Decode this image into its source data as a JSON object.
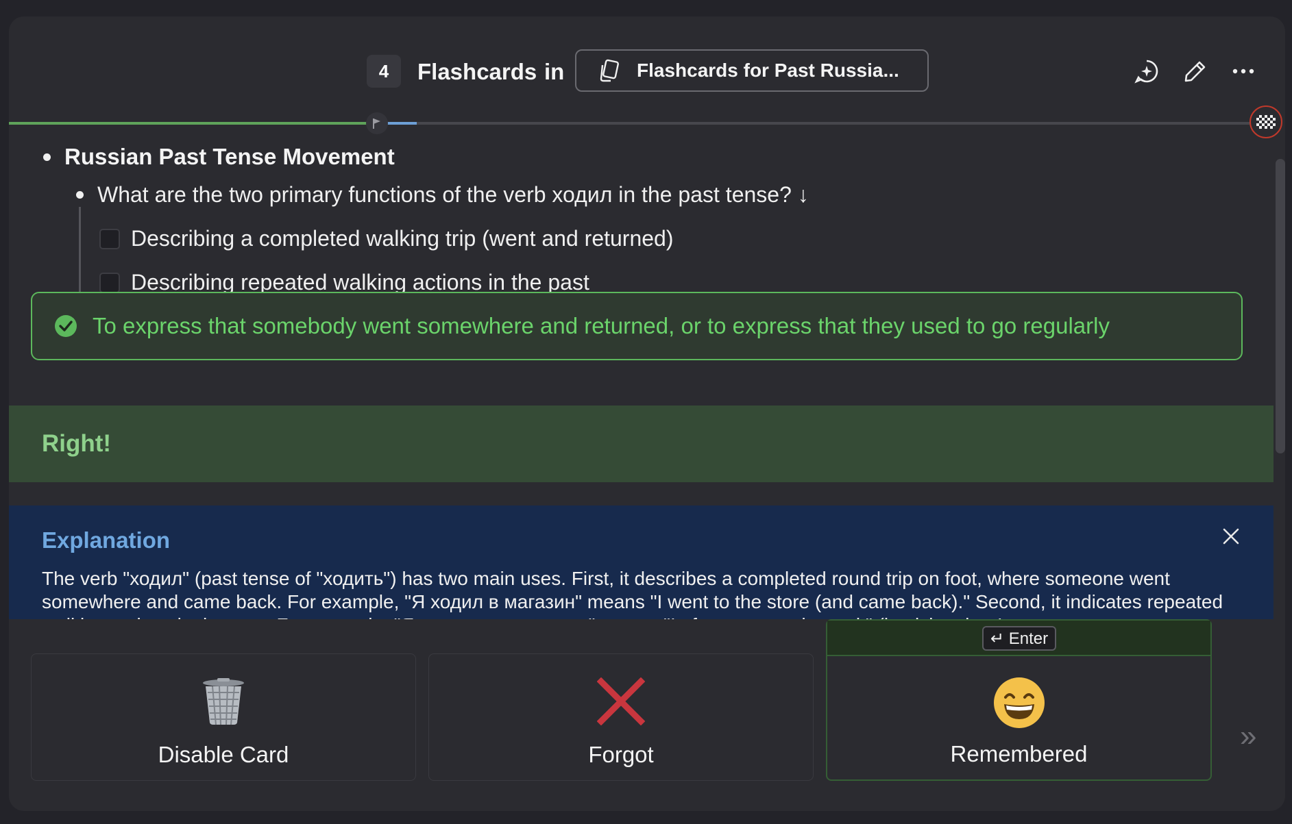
{
  "header": {
    "count": "4",
    "title": "Flashcards",
    "in_word": "in",
    "deck_name": "Flashcards for Past Russia..."
  },
  "progress": {
    "completed_fraction": 0.29,
    "current_fraction": 0.03
  },
  "outline": {
    "topic": "Russian Past Tense Movement",
    "question": "What are the two primary functions of the verb ходил in the past tense? ↓",
    "options": [
      "Describing a completed walking trip (went and returned)",
      "Describing repeated walking actions in the past"
    ]
  },
  "answer": "To express that somebody went somewhere and returned, or to express that they used to go regularly",
  "result": "Right!",
  "explanation": {
    "heading": "Explanation",
    "body": "The verb \"ходил\" (past tense of \"ходить\") has two main uses. First, it describes a completed round trip on foot, where someone went somewhere and came back. For example, \"Я ходил в магазин\" means \"I went to the store (and came back).\" Second, it indicates repeated walking actions in the past. For example, \"Я часто ходил в парк\" means \"I often went to the park\" (implying that I"
  },
  "actions": {
    "disable": "Disable Card",
    "forgot": "Forgot",
    "remembered": "Remembered",
    "enter_hint": "↵ Enter"
  },
  "colors": {
    "success": "#5cb85c",
    "result_bg": "#354b36",
    "explanation_bg": "#172a4d",
    "forgot_red": "#c9363e"
  }
}
